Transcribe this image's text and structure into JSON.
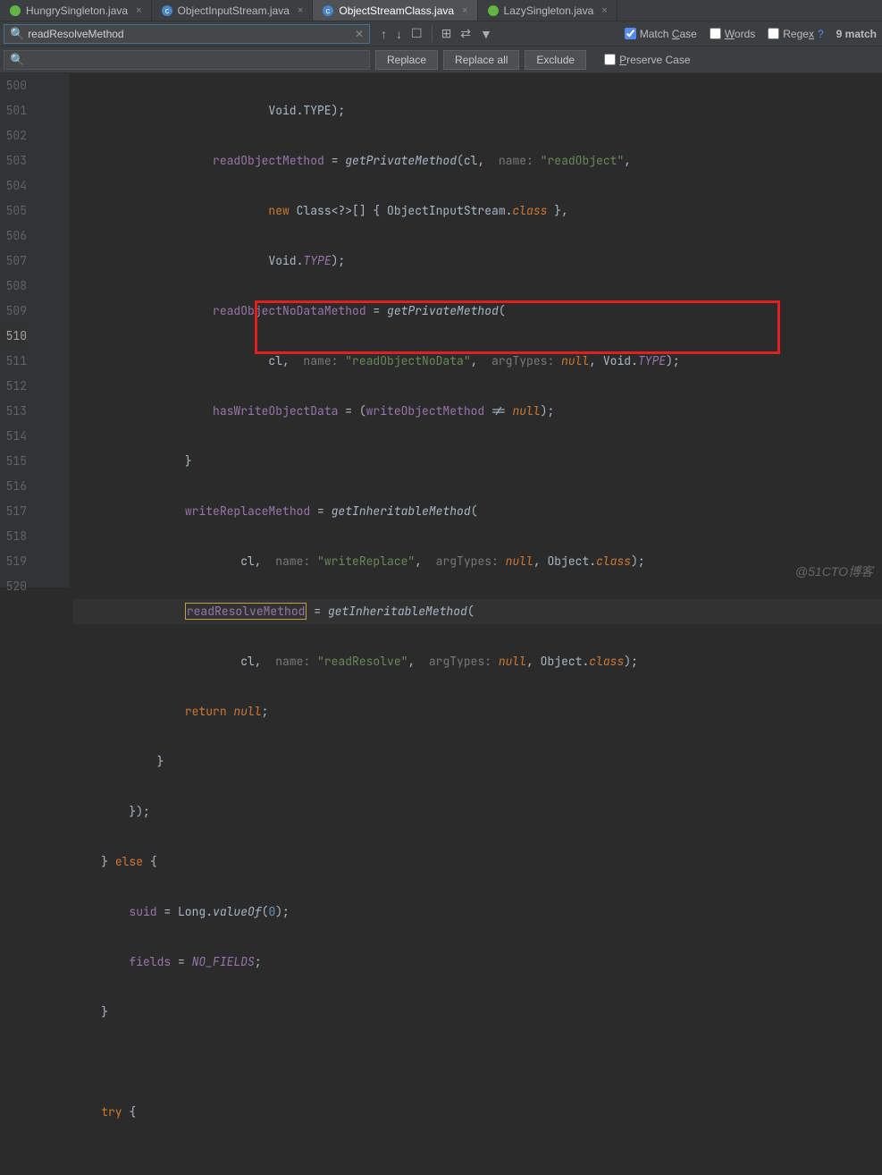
{
  "tabs": [
    {
      "label": "HungrySingleton.java",
      "active": false,
      "icon": "java-leaf"
    },
    {
      "label": "ObjectInputStream.java",
      "active": false,
      "icon": "java-class"
    },
    {
      "label": "ObjectStreamClass.java",
      "active": true,
      "icon": "java-class"
    },
    {
      "label": "LazySingleton.java",
      "active": false,
      "icon": "java-leaf"
    }
  ],
  "search": {
    "value": "readResolveMethod",
    "match_count_label": "9 match"
  },
  "options": {
    "match_case": {
      "label": "Match Case",
      "checked": true,
      "ul": "C"
    },
    "words": {
      "label": "Words",
      "checked": false,
      "ul": "W"
    },
    "regex": {
      "label": "Regex",
      "checked": false,
      "ul": "x",
      "help": "?"
    },
    "preserve_case": {
      "label": "Preserve Case",
      "checked": false,
      "ul": "P"
    }
  },
  "buttons": {
    "replace": "Replace",
    "replace_all": "Replace all",
    "exclude": "Exclude"
  },
  "lines": {
    "start": 500,
    "end": 520
  },
  "code": {
    "l500": "Void.TYPE);",
    "l501a": "readObjectMethod",
    "l501b": " = ",
    "l501c": "getPrivateMethod",
    "l501d": "(cl,  ",
    "l501e": "name: ",
    "l501f": "\"readObject\"",
    "l501g": ",",
    "l502a": "new",
    "l502b": " Class<?>[] { ObjectInputStream.",
    "l502c": "class",
    "l502d": " },",
    "l503a": "Void.",
    "l503b": "TYPE",
    "l503c": ");",
    "l504a": "readObjectNoDataMethod",
    "l504b": " = ",
    "l504c": "getPrivateMethod",
    "l504d": "(",
    "l505a": "cl,  ",
    "l505b": "name: ",
    "l505c": "\"readObjectNoData\"",
    "l505d": ",  ",
    "l505e": "argTypes: ",
    "l505f": "null",
    "l505g": ", Void.",
    "l505h": "TYPE",
    "l505i": ");",
    "l506a": "hasWriteObjectData",
    "l506b": " = (",
    "l506c": "writeObjectMethod",
    "l506d": " != ",
    "l506e": "null",
    "l506f": ");",
    "l507": "}",
    "l508a": "writeReplaceMethod",
    "l508b": " = ",
    "l508c": "getInheritableMethod",
    "l508d": "(",
    "l509a": "cl,  ",
    "l509b": "name: ",
    "l509c": "\"writeReplace\"",
    "l509d": ",  ",
    "l509e": "argTypes: ",
    "l509f": "null",
    "l509g": ", Object.",
    "l509h": "class",
    "l509i": ");",
    "l510a": "readResolveMethod",
    "l510b": " = ",
    "l510c": "getInheritableMethod",
    "l510d": "(",
    "l511a": "cl,  ",
    "l511b": "name: ",
    "l511c": "\"readResolve\"",
    "l511d": ",  ",
    "l511e": "argTypes: ",
    "l511f": "null",
    "l511g": ", Object.",
    "l511h": "class",
    "l511i": ");",
    "l512a": "return ",
    "l512b": "null",
    "l512c": ";",
    "l513": "}",
    "l514": "});",
    "l515a": "} ",
    "l515b": "else",
    "l515c": " {",
    "l516a": "suid",
    "l516b": " = Long.",
    "l516c": "valueOf",
    "l516d": "(",
    "l516e": "0",
    "l516f": ");",
    "l517a": "fields",
    "l517b": " = ",
    "l517c": "NO_FIELDS",
    "l517d": ";",
    "l518": "}",
    "l519": "",
    "l520a": "try",
    "l520b": " {"
  },
  "watermark": "@51CTO博客"
}
